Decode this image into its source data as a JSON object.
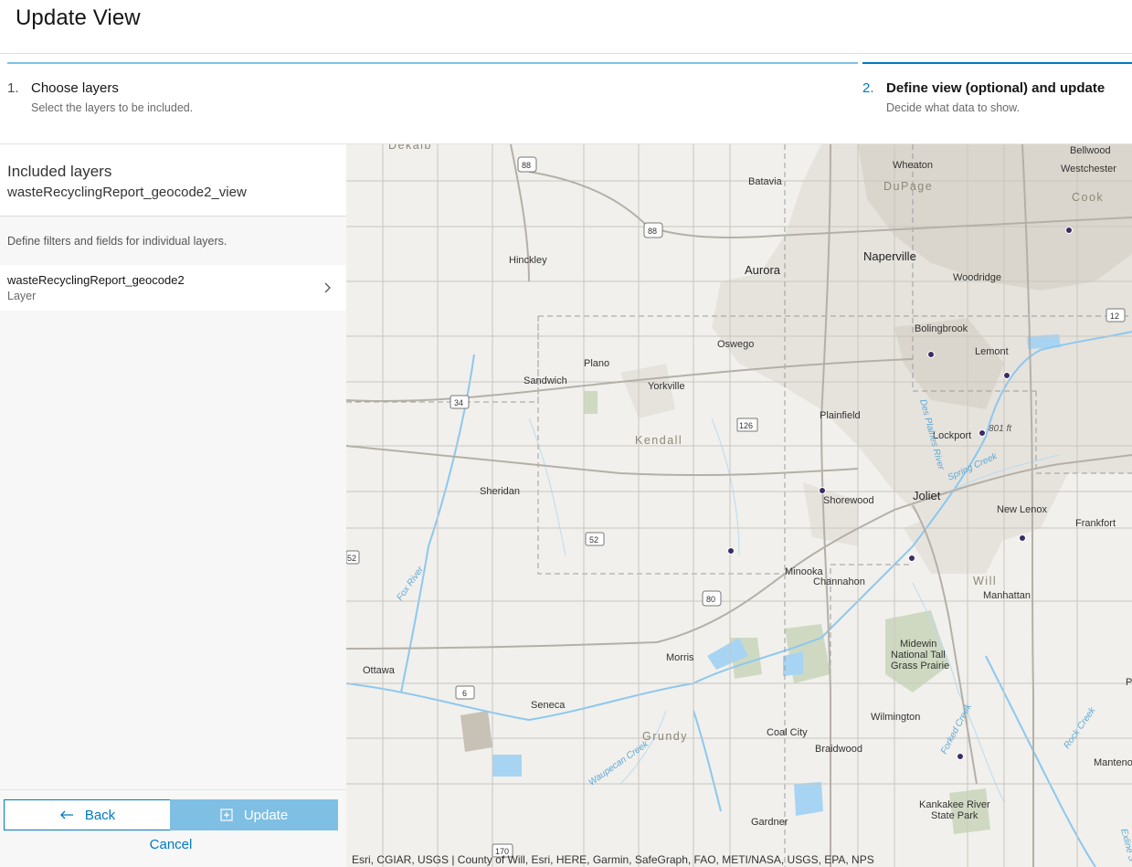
{
  "page": {
    "title": "Update View"
  },
  "steps": [
    {
      "number": "1.",
      "label": "Choose layers",
      "description": "Select the layers to be included."
    },
    {
      "number": "2.",
      "label": "Define view (optional) and update",
      "description": "Decide what data to show."
    }
  ],
  "left_panel": {
    "included_title": "Included layers",
    "view_name": "wasteRecyclingReport_geocode2_view",
    "define_text": "Define filters and fields for individual layers.",
    "layer": {
      "name": "wasteRecyclingReport_geocode2",
      "type": "Layer"
    }
  },
  "footer": {
    "back_label": "Back",
    "update_label": "Update",
    "cancel_label": "Cancel"
  },
  "map": {
    "attribution": "Esri, CGIAR, USGS | County of Will, Esri, HERE, Garmin, SafeGraph, FAO, METI/NASA, USGS, EPA, NPS",
    "places": [
      "Dekalb",
      "Batavia",
      "Wheaton",
      "DuPage",
      "Bellwood",
      "Westchester",
      "Cook",
      "Hinckley",
      "Aurora",
      "Naperville",
      "Woodridge",
      "Bolingbrook",
      "Lemont",
      "Oswego",
      "Plano",
      "Sandwich",
      "Yorkville",
      "Plainfield",
      "Lockport",
      "Kendall",
      "Sheridan",
      "Shorewood",
      "Joliet",
      "New Lenox",
      "Frankfort",
      "Minooka",
      "Channahon",
      "Will",
      "Manhattan",
      "Midewin",
      "National Tall",
      "Grass Prairie",
      "Morris",
      "Ottawa",
      "Seneca",
      "Wilmington",
      "Grundy",
      "Coal City",
      "Braidwood",
      "Manteno",
      "Kankakee River",
      "State Park",
      "Gardner",
      "P"
    ],
    "water_labels": [
      "Fox River",
      "Des Plaines River",
      "Spring Creek",
      "Waupecan Creek",
      "Forked Creek",
      "Rock Creek",
      "Exline S"
    ],
    "shields": [
      "88",
      "88",
      "34",
      "126",
      "12",
      "52",
      "52",
      "80",
      "6",
      "170"
    ],
    "elevation": "801 ft",
    "point_color": "#3d2c63"
  },
  "colors": {
    "accent": "#0079c1",
    "accent_light": "#7fbfe4"
  }
}
